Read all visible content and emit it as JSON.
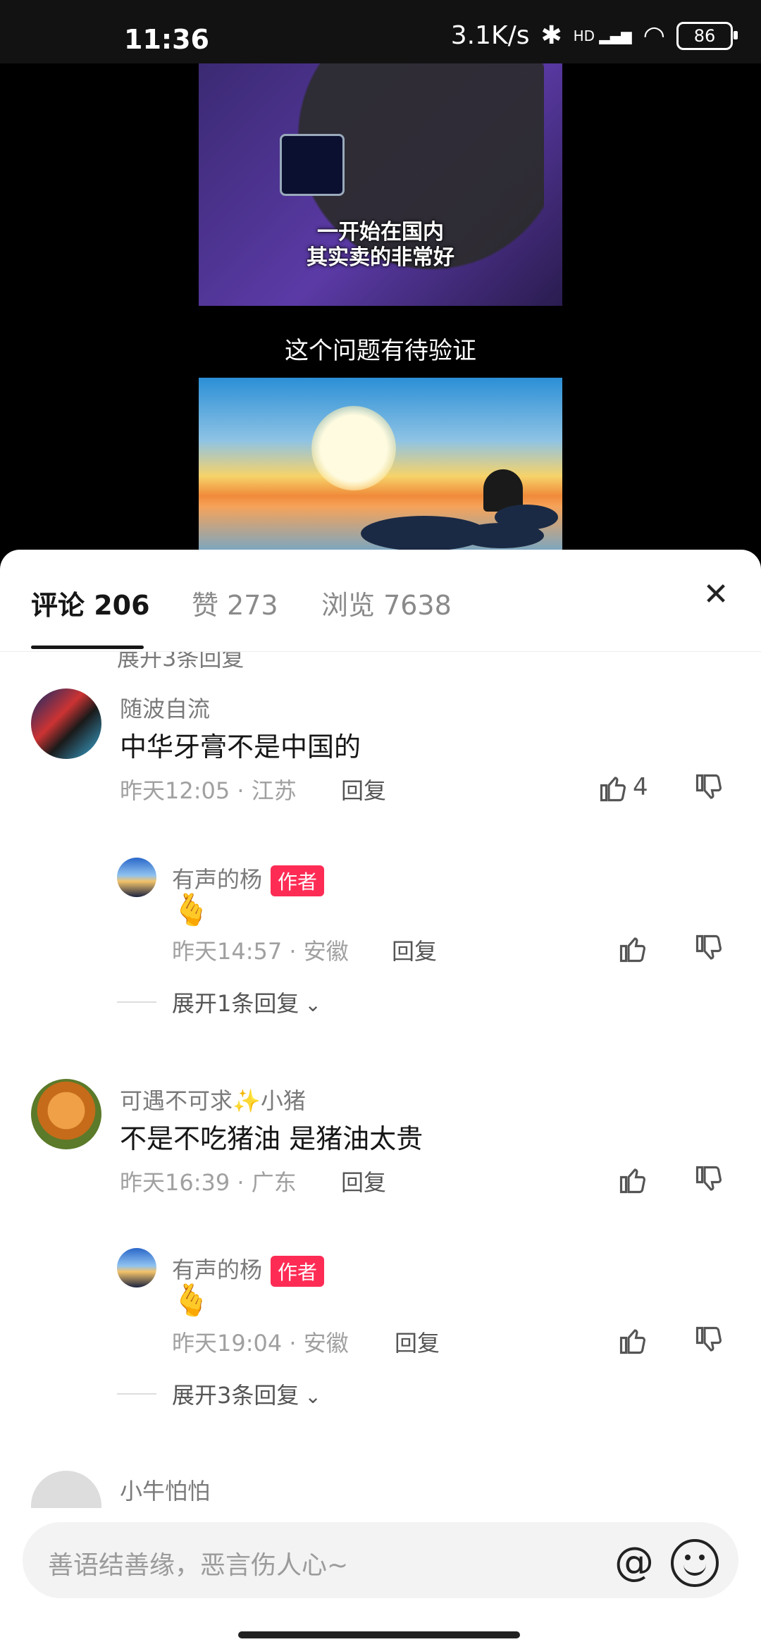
{
  "status_bar": {
    "time": "11:36",
    "network_speed": "3.1K/s",
    "bluetooth_icon": "bluetooth-icon",
    "signal_icon": "cell-signal-icon",
    "signal_label": "HD",
    "wifi_icon": "wifi-icon",
    "battery_level": "86"
  },
  "video": {
    "caption_line1": "一开始在国内",
    "caption_line2": "其实卖的非常好",
    "title": "这个问题有待验证"
  },
  "tabs": [
    {
      "label": "评论 206",
      "active": true
    },
    {
      "label": "赞 273",
      "active": false
    },
    {
      "label": "浏览 7638",
      "active": false
    }
  ],
  "header": {
    "close_icon": "close-icon"
  },
  "partial_expand": "展开3条回复",
  "comments": [
    {
      "name": "随波自流",
      "text": "中华牙膏不是中国的",
      "meta": "昨天12:05 · 江苏",
      "reply_label": "回复",
      "like_count": "4",
      "replies": [
        {
          "name": "有声的杨",
          "badge": "作者",
          "emoji": "🫰",
          "meta": "昨天14:57 · 安徽",
          "reply_label": "回复"
        }
      ],
      "expand": "展开1条回复"
    },
    {
      "name": "可遇不可求✨小猪",
      "text": "不是不吃猪油 是猪油太贵",
      "meta": "昨天16:39 · 广东",
      "reply_label": "回复",
      "replies": [
        {
          "name": "有声的杨",
          "badge": "作者",
          "emoji": "🫰",
          "meta": "昨天19:04 · 安徽",
          "reply_label": "回复"
        }
      ],
      "expand": "展开3条回复"
    },
    {
      "name": "小牛怕怕"
    }
  ],
  "input": {
    "placeholder": "善语结善缘，恶言伤人心~",
    "at_icon": "at-icon",
    "emoji_icon": "emoji-icon"
  },
  "colors": {
    "author_badge": "#fe2c55",
    "text_primary": "#161616",
    "text_secondary": "#7a7a7a"
  }
}
